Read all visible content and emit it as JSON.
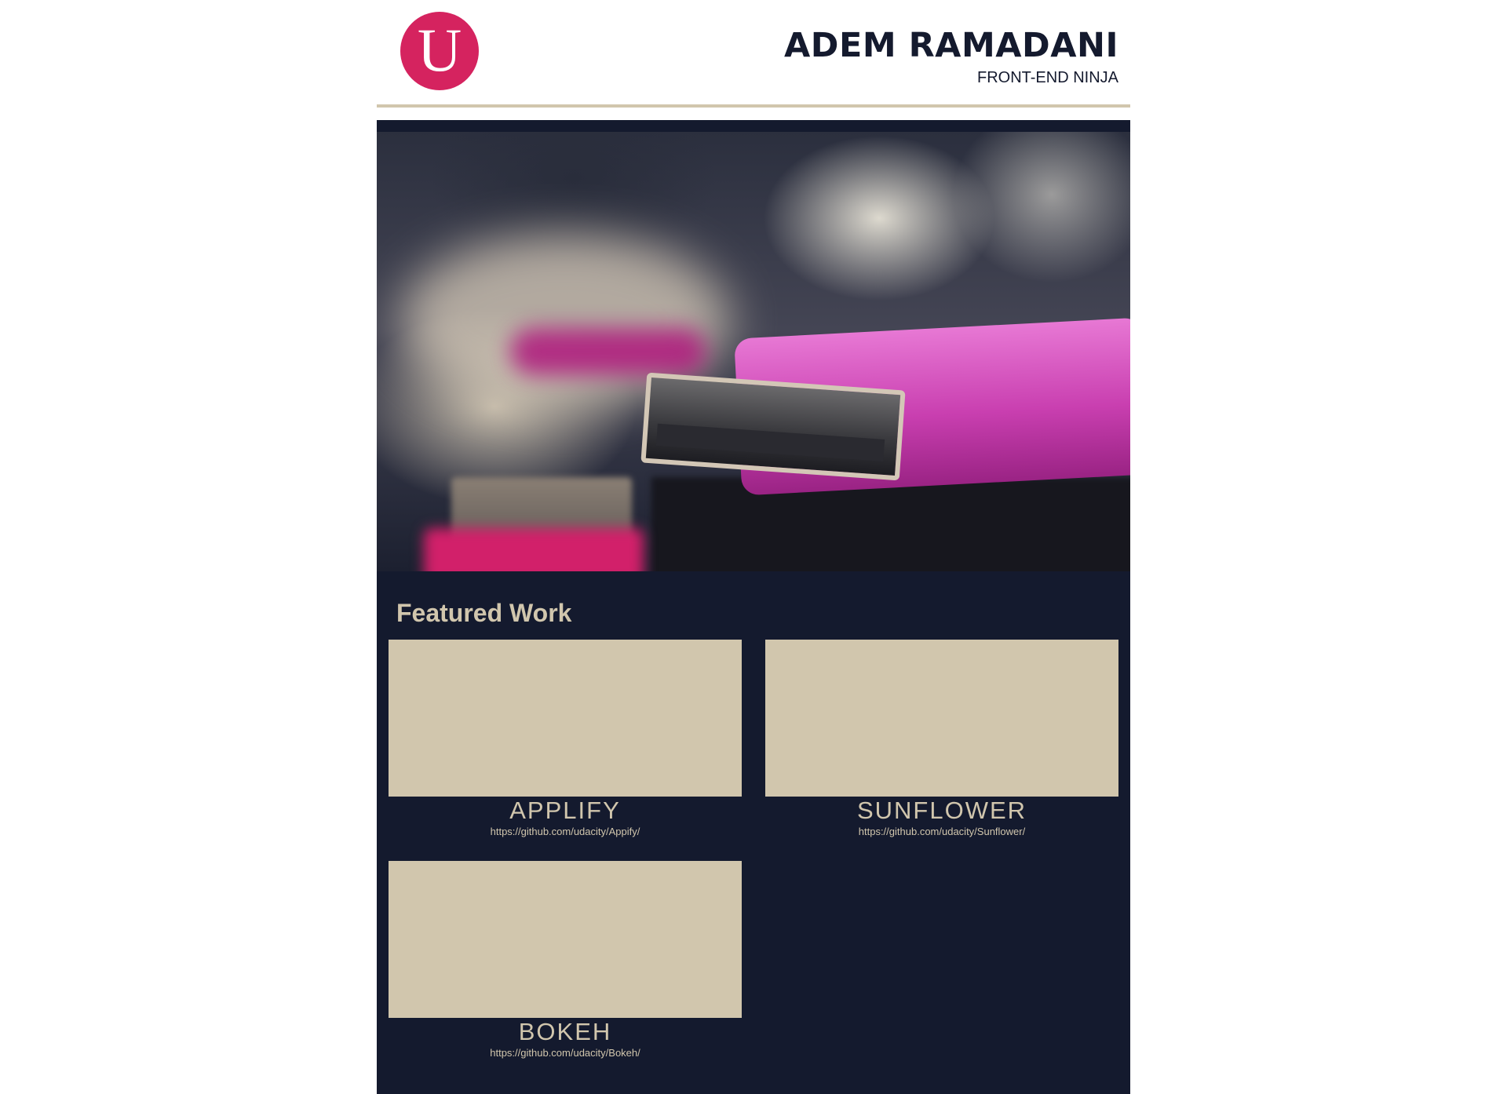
{
  "header": {
    "logo_letter": "U",
    "name": "ADEM RAMADANI",
    "role": "FRONT-END NINJA"
  },
  "hero": {
    "image_icon": "usb-drive-photo"
  },
  "featured": {
    "title": "Featured Work",
    "projects": [
      {
        "title": "APPLIFY",
        "url": "https://github.com/udacity/Appify/"
      },
      {
        "title": "SUNFLOWER",
        "url": "https://github.com/udacity/Sunflower/"
      },
      {
        "title": "BOKEH",
        "url": "https://github.com/udacity/Bokeh/"
      }
    ]
  },
  "colors": {
    "accent": "#d5235f",
    "navy": "#141a2e",
    "tan": "#d1c6ad",
    "white": "#ffffff"
  }
}
